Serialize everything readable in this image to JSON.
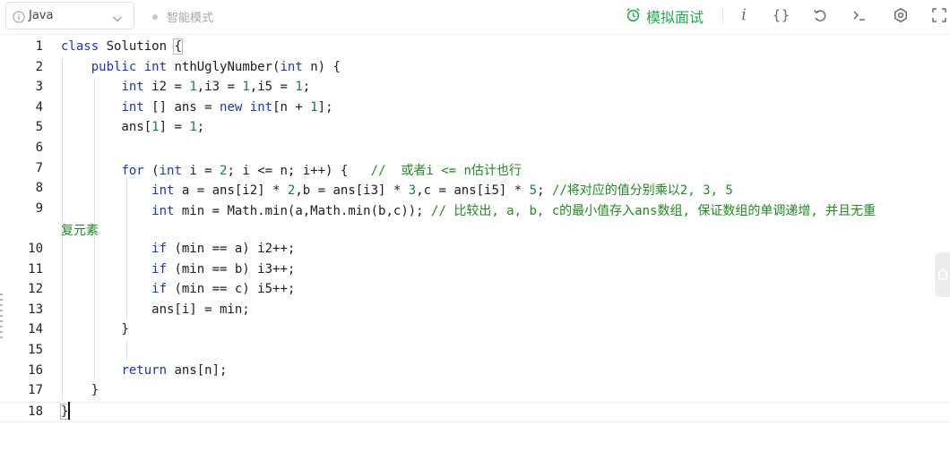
{
  "toolbar": {
    "language": "Java",
    "smart_mode_label": "智能模式",
    "mock_interview_label": "模拟面试",
    "icons": [
      "info-icon",
      "chevron-down-icon",
      "alarm-clock-icon",
      "italic-i-icon",
      "braces-icon",
      "undo-icon",
      "terminal-icon",
      "settings-icon",
      "fullscreen-icon"
    ]
  },
  "colors": {
    "keyword": "#1a33cc",
    "number": "#118044",
    "comment": "#1c8b1c",
    "accent_green": "#1eac4e"
  },
  "editor": {
    "lines": [
      {
        "no": "1",
        "html": "<span class=\"kw\">class</span> Solution <span class=\"bracket-hl\">{</span>"
      },
      {
        "no": "2",
        "html": "    <span class=\"kw\">public</span> <span class=\"kw\">int</span> nthUglyNumber(<span class=\"kw\">int</span> n) {"
      },
      {
        "no": "3",
        "html": "        <span class=\"kw\">int</span> i2 = <span class=\"num\">1</span>,i3 = <span class=\"num\">1</span>,i5 = <span class=\"num\">1</span>;"
      },
      {
        "no": "4",
        "html": "        <span class=\"kw\">int</span> [] ans = <span class=\"kw\">new</span> <span class=\"kw\">int</span>[n + <span class=\"num\">1</span>];"
      },
      {
        "no": "5",
        "html": "        ans[<span class=\"num\">1</span>] = <span class=\"num\">1</span>;"
      },
      {
        "no": "6",
        "html": ""
      },
      {
        "no": "7",
        "html": "        <span class=\"kw\">for</span> (<span class=\"kw\">int</span> i = <span class=\"num\">2</span>; i &lt;= n; i++) {   <span class=\"cm\">//  或者i &lt;= n估计也行</span>"
      },
      {
        "no": "8",
        "html": "            <span class=\"kw\">int</span> a = ans[i2] * <span class=\"num\">2</span>,b = ans[i3] * <span class=\"num\">3</span>,c = ans[i5] * <span class=\"num\">5</span>; <span class=\"cm\">//将对应的值分别乘以2, 3, 5</span>"
      },
      {
        "no": "9",
        "html": "            <span class=\"kw\">int</span> min = Math.min(a,Math.min(b,c)); <span class=\"cm\">// 比较出, a, b, c的最小值存入ans数组, 保证数组的单调递增, 并且无重</span>"
      },
      {
        "no": "",
        "html": "<span class=\"cm\">复元素</span>"
      },
      {
        "no": "10",
        "html": "            <span class=\"kw\">if</span> (min == a) i2++;"
      },
      {
        "no": "11",
        "html": "            <span class=\"kw\">if</span> (min == b) i3++;"
      },
      {
        "no": "12",
        "html": "            <span class=\"kw\">if</span> (min == c) i5++;"
      },
      {
        "no": "13",
        "html": "            ans[i] = min;"
      },
      {
        "no": "14",
        "html": "        }"
      },
      {
        "no": "15",
        "html": ""
      },
      {
        "no": "16",
        "html": "        <span class=\"kw\">return</span> ans[n];"
      },
      {
        "no": "17",
        "html": "    }"
      },
      {
        "no": "18",
        "html": "<span class=\"bracket-hl\">}</span>"
      }
    ]
  }
}
